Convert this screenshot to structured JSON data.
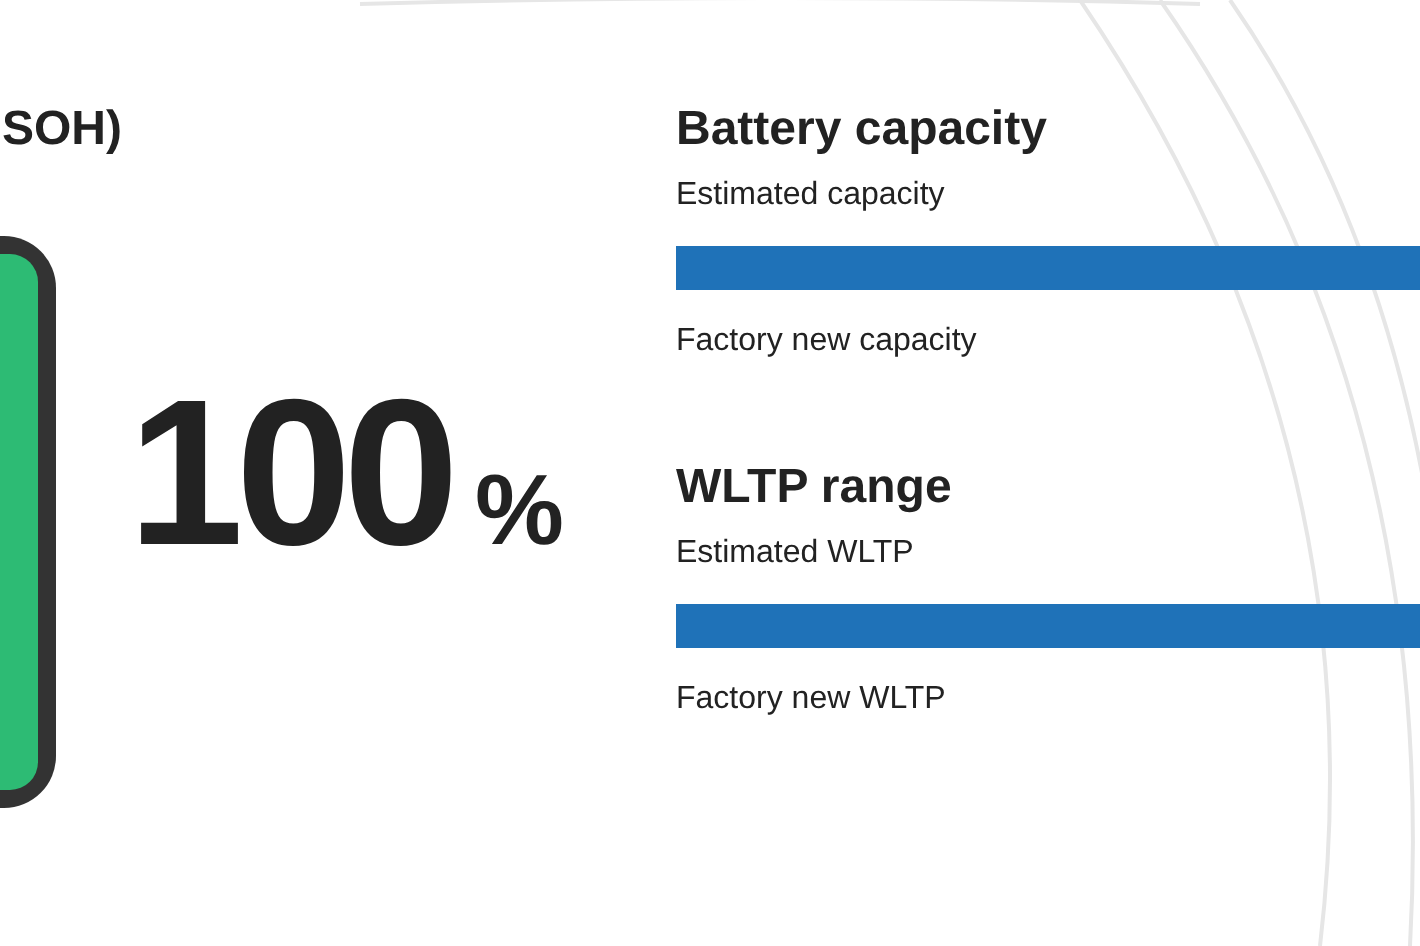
{
  "soh": {
    "title": "SOH)",
    "value": "100",
    "unit": "%"
  },
  "sections": [
    {
      "title": "Battery capacity",
      "estimated_label": "Estimated capacity",
      "factory_label": "Factory new capacity"
    },
    {
      "title": "WLTP range",
      "estimated_label": "Estimated WLTP",
      "factory_label": "Factory new WLTP"
    }
  ]
}
